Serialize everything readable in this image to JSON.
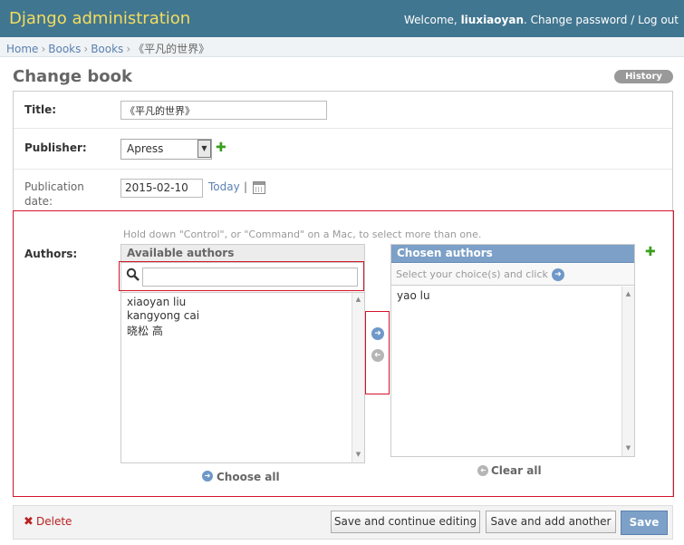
{
  "header": {
    "site_title": "Django administration",
    "welcome": "Welcome,",
    "username": "liuxiaoyan",
    "change_password": "Change password",
    "separator": "/",
    "logout": "Log out"
  },
  "breadcrumbs": {
    "home": "Home",
    "app": "Books",
    "model": "Books",
    "current": "《平凡的世界》",
    "sep": "›"
  },
  "page": {
    "title": "Change book",
    "history_label": "History"
  },
  "form": {
    "title_label": "Title:",
    "title_value": "《平凡的世界》",
    "publisher_label": "Publisher:",
    "publisher_value": "Apress",
    "pubdate_label": "Publication date:",
    "pubdate_label_line1": "Publication",
    "pubdate_label_line2": "date:",
    "pubdate_value": "2015-02-10",
    "today_link": "Today",
    "today_sep": "|",
    "authors_label": "Authors:",
    "authors_help": "Hold down \"Control\", or \"Command\" on a Mac, to select more than one.",
    "available": {
      "header": "Available authors",
      "search_value": "",
      "items": [
        "xiaoyan liu",
        "kangyong cai",
        "晓松 高"
      ],
      "choose_all": "Choose all"
    },
    "chosen": {
      "header": "Chosen authors",
      "help": "Select your choice(s) and click",
      "items": [
        "yao lu"
      ],
      "clear_all": "Clear all"
    }
  },
  "actions": {
    "delete": "Delete",
    "save_continue": "Save and continue editing",
    "save_add": "Save and add another",
    "save": "Save"
  },
  "colors": {
    "header_bg": "#417690",
    "site_title": "#f5dd5d",
    "link": "#5b80b2",
    "delete": "#ba2121",
    "highlight_box": "#d3142a"
  },
  "icons": {
    "add": "plus-icon",
    "calendar": "calendar-icon",
    "search": "search-icon",
    "add_arrow": "arrow-right-icon",
    "remove_arrow": "arrow-left-icon",
    "delete": "x-icon"
  }
}
